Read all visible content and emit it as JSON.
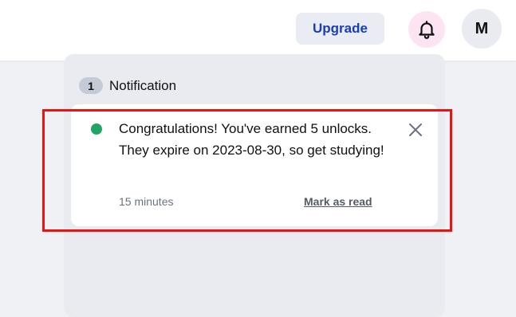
{
  "header": {
    "upgrade_label": "Upgrade",
    "bell_icon": "bell-icon",
    "avatar_initial": "M"
  },
  "notifications": {
    "count": "1",
    "title": "Notification",
    "items": [
      {
        "status_color": "#21a463",
        "message": "Congratulations! You've earned 5 unlocks. They expire on 2023-08-30, so get studying!",
        "time": "15 minutes",
        "action_label": "Mark as read",
        "close_icon": "close-icon"
      }
    ]
  },
  "colors": {
    "accent": "#1a3db8",
    "highlight": "#ee1111",
    "unread_dot": "#21a463"
  }
}
